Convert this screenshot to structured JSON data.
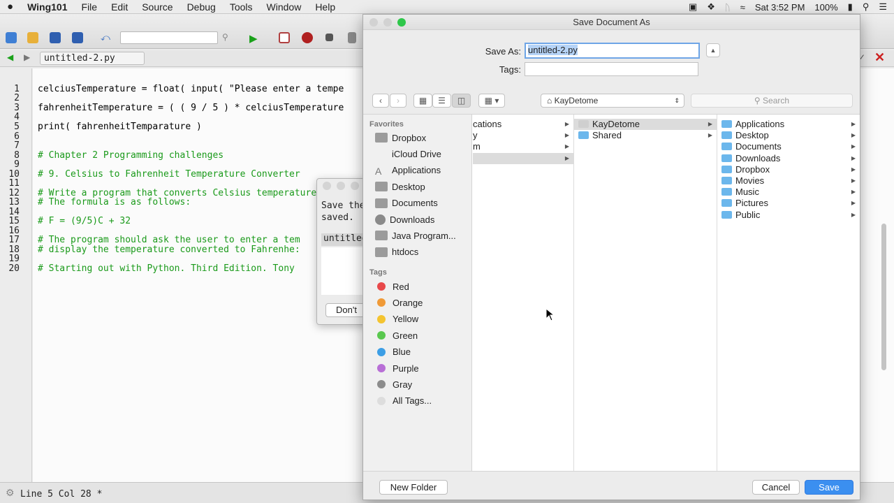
{
  "menubar": {
    "apple": "",
    "app_name": "Wing101",
    "items": [
      "File",
      "Edit",
      "Source",
      "Debug",
      "Tools",
      "Window",
      "Help"
    ],
    "clock": "Sat 3:52 PM",
    "battery": "100%"
  },
  "editor": {
    "tab_label": "untitled-2.py",
    "lines": [
      {
        "n": "1",
        "text": "celciusTemperature = float( input( \"Please enter a tempe",
        "type": "code"
      },
      {
        "n": "2",
        "text": "",
        "type": "code"
      },
      {
        "n": "3",
        "text": "fahrenheitTemperature = ( ( 9 / 5 ) * celciusTemperature",
        "type": "code"
      },
      {
        "n": "4",
        "text": "",
        "type": "code"
      },
      {
        "n": "5",
        "text": "print( fahrenheitTemparature )",
        "type": "code"
      },
      {
        "n": "6",
        "text": "",
        "type": "code"
      },
      {
        "n": "7",
        "text": "",
        "type": "code"
      },
      {
        "n": "8",
        "text": "# Chapter 2 Programming challenges",
        "type": "cmt"
      },
      {
        "n": "9",
        "text": "",
        "type": "code"
      },
      {
        "n": "10",
        "text": "# 9. Celsius to Fahrenheit Temperature Converter",
        "type": "cmt"
      },
      {
        "n": "11",
        "text": "",
        "type": "code"
      },
      {
        "n": "12",
        "text": "# Write a program that converts Celsius temperatures to",
        "type": "cmt"
      },
      {
        "n": "13",
        "text": "# The formula is as follows:",
        "type": "cmt"
      },
      {
        "n": "14",
        "text": "",
        "type": "code"
      },
      {
        "n": "15",
        "text": "# F = (9/5)C + 32",
        "type": "cmt"
      },
      {
        "n": "16",
        "text": "",
        "type": "code"
      },
      {
        "n": "17",
        "text": "# The program should ask the user to enter a tem",
        "type": "cmt"
      },
      {
        "n": "18",
        "text": "# display the temperature converted to Fahrenhe:",
        "type": "cmt"
      },
      {
        "n": "19",
        "text": "",
        "type": "code"
      },
      {
        "n": "20",
        "text": "# Starting out with Python. Third Edition. Tony",
        "type": "cmt"
      }
    ],
    "status": "Line 5 Col 28 *"
  },
  "back_dialog": {
    "message": "Save the\nsaved.",
    "field": "untitled",
    "button": "Don't"
  },
  "save_dialog": {
    "title": "Save Document As",
    "save_as_label": "Save As:",
    "save_as_value": "untitled-2.py",
    "tags_label": "Tags:",
    "location": "KayDetome",
    "search_placeholder": "Search",
    "favorites_heading": "Favorites",
    "favorites": [
      "Dropbox",
      "iCloud Drive",
      "Applications",
      "Desktop",
      "Documents",
      "Downloads",
      "Java Program...",
      "htdocs"
    ],
    "tags_heading": "Tags",
    "tags": [
      {
        "name": "Red",
        "color": "#e8484a"
      },
      {
        "name": "Orange",
        "color": "#f09a37"
      },
      {
        "name": "Yellow",
        "color": "#f4c430"
      },
      {
        "name": "Green",
        "color": "#5ac84f"
      },
      {
        "name": "Blue",
        "color": "#3c9ee5"
      },
      {
        "name": "Purple",
        "color": "#b86fd6"
      },
      {
        "name": "Gray",
        "color": "#8c8c8c"
      },
      {
        "name": "All Tags...",
        "color": "#dddddd"
      }
    ],
    "column1": [
      "cations",
      "y",
      "m",
      ""
    ],
    "column2": [
      "KayDetome",
      "Shared"
    ],
    "column3": [
      "Applications",
      "Desktop",
      "Documents",
      "Downloads",
      "Dropbox",
      "Movies",
      "Music",
      "Pictures",
      "Public"
    ],
    "new_folder": "New Folder",
    "cancel": "Cancel",
    "save": "Save",
    "accent": "#3b8ff0"
  }
}
